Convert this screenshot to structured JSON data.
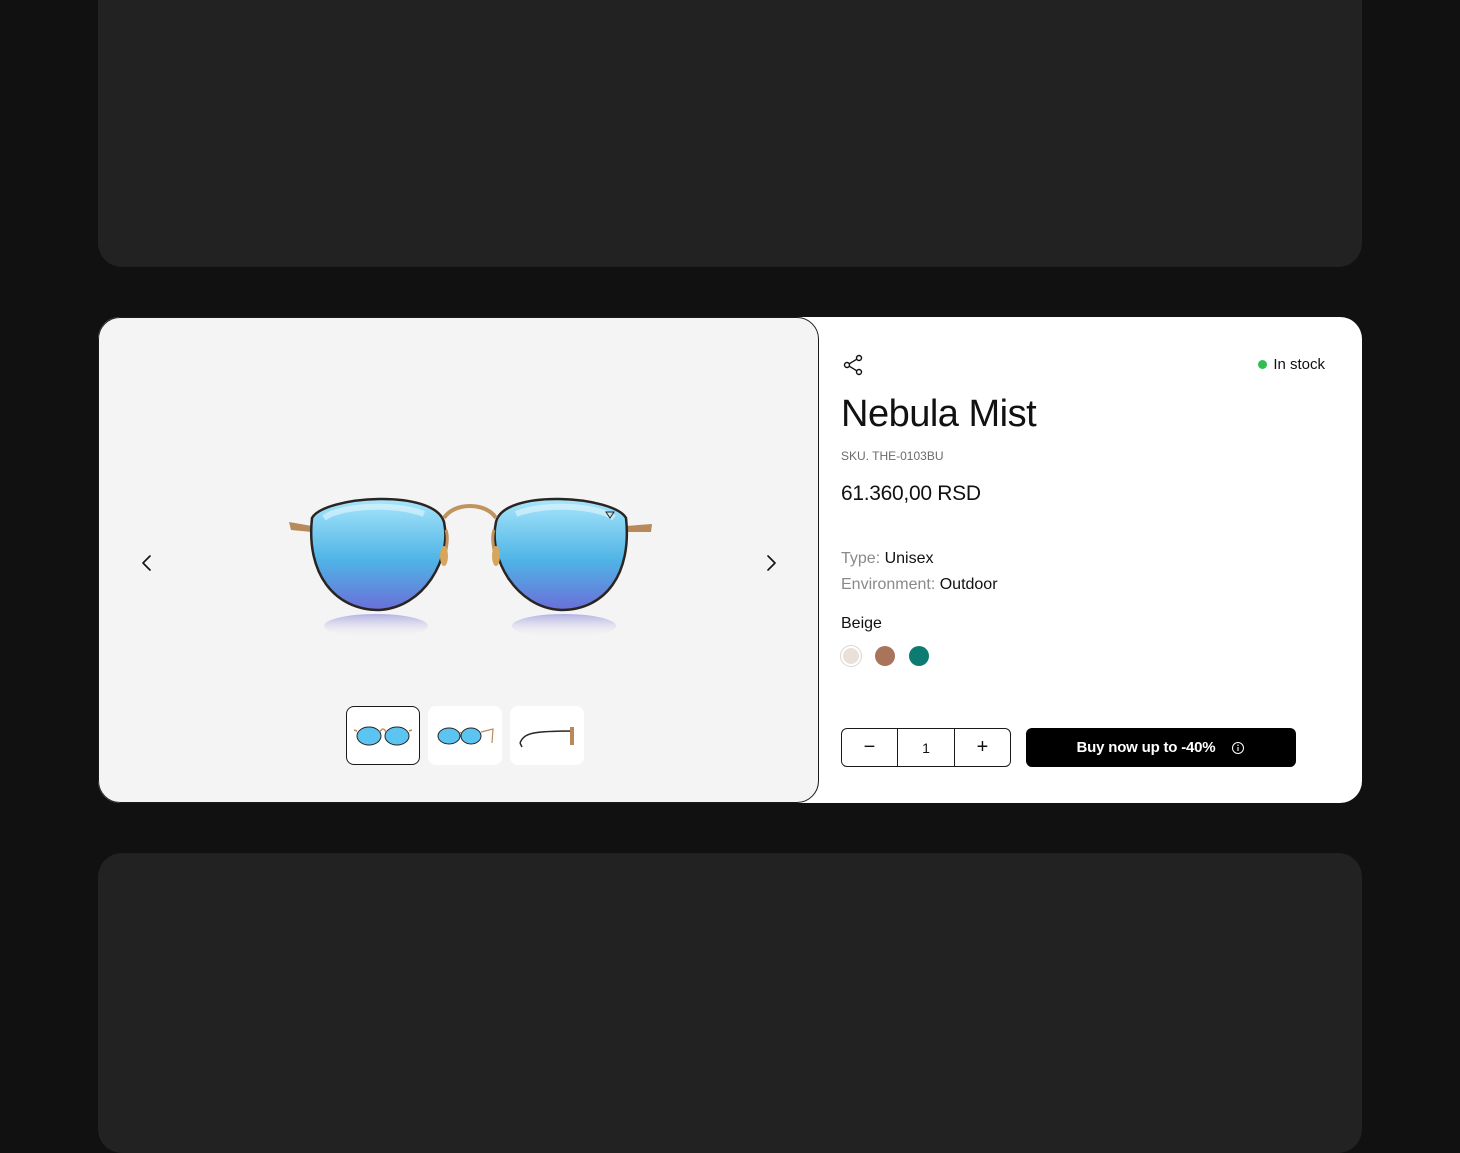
{
  "product": {
    "title": "Nebula Mist",
    "sku": "SKU. THE-0103BU",
    "price": "61.360,00 RSD",
    "stock_status": "In stock",
    "type_label": "Type:",
    "type_value": "Unisex",
    "environment_label": "Environment:",
    "environment_value": "Outdoor",
    "selected_color": "Beige",
    "colors": [
      {
        "name": "Beige",
        "hex": "#e9e1d9"
      },
      {
        "name": "Brown",
        "hex": "#a9735c"
      },
      {
        "name": "Teal",
        "hex": "#0c7b72"
      }
    ]
  },
  "quantity": {
    "value": "1",
    "decrease": "−",
    "increase": "+"
  },
  "buy_button": {
    "label": "Buy now up to -40%"
  },
  "gallery": {
    "thumbnails": [
      "front view",
      "angled view",
      "side view"
    ],
    "active_index": 0
  },
  "theme": {
    "page_bg": "#111111",
    "placeholder_card": "#222222",
    "gallery_bg": "#f4f4f4",
    "stock_dot": "#2fbf4f",
    "lens_blue": "#5cc4f0"
  }
}
